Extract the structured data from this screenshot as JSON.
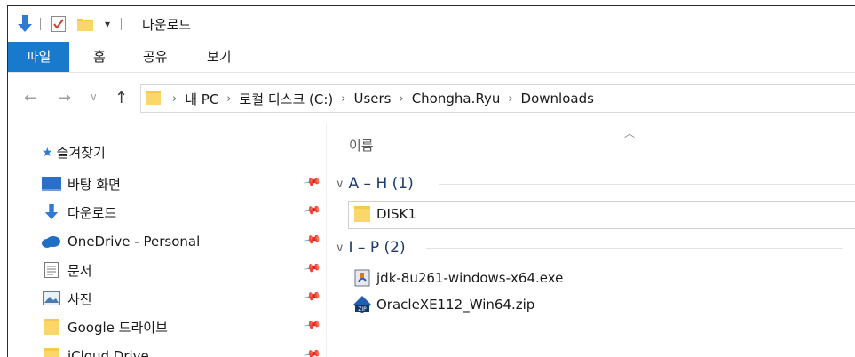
{
  "window": {
    "title": "다운로드"
  },
  "ribbon": {
    "tabs": [
      "파일",
      "홈",
      "공유",
      "보기"
    ]
  },
  "address": {
    "crumbs": [
      "내 PC",
      "로컬 디스크 (C:)",
      "Users",
      "Chongha.Ryu",
      "Downloads"
    ]
  },
  "navpane": {
    "quick_access_label": "즐겨찾기",
    "items": [
      {
        "label": "바탕 화면",
        "icon": "desktop-icon",
        "pinned": true
      },
      {
        "label": "다운로드",
        "icon": "download-arrow-icon",
        "pinned": true
      },
      {
        "label": "OneDrive - Personal",
        "icon": "cloud-icon",
        "pinned": true
      },
      {
        "label": "문서",
        "icon": "document-icon",
        "pinned": true
      },
      {
        "label": "사진",
        "icon": "pictures-icon",
        "pinned": true
      },
      {
        "label": "Google 드라이브",
        "icon": "folder-icon",
        "pinned": true
      },
      {
        "label": "iCloud Drive",
        "icon": "folder-icon",
        "pinned": true
      }
    ]
  },
  "content": {
    "column_header": "이름",
    "groups": [
      {
        "label": "A – H (1)",
        "files": [
          {
            "name": "DISK1",
            "icon": "folder-icon"
          }
        ]
      },
      {
        "label": "I – P (2)",
        "files": [
          {
            "name": "jdk-8u261-windows-x64.exe",
            "icon": "installer-icon"
          },
          {
            "name": "OracleXE112_Win64.zip",
            "icon": "zip-icon"
          }
        ]
      }
    ]
  },
  "colors": {
    "accent": "#1979ca",
    "folder": "#f7c948",
    "group_text": "#1e3b6e"
  }
}
